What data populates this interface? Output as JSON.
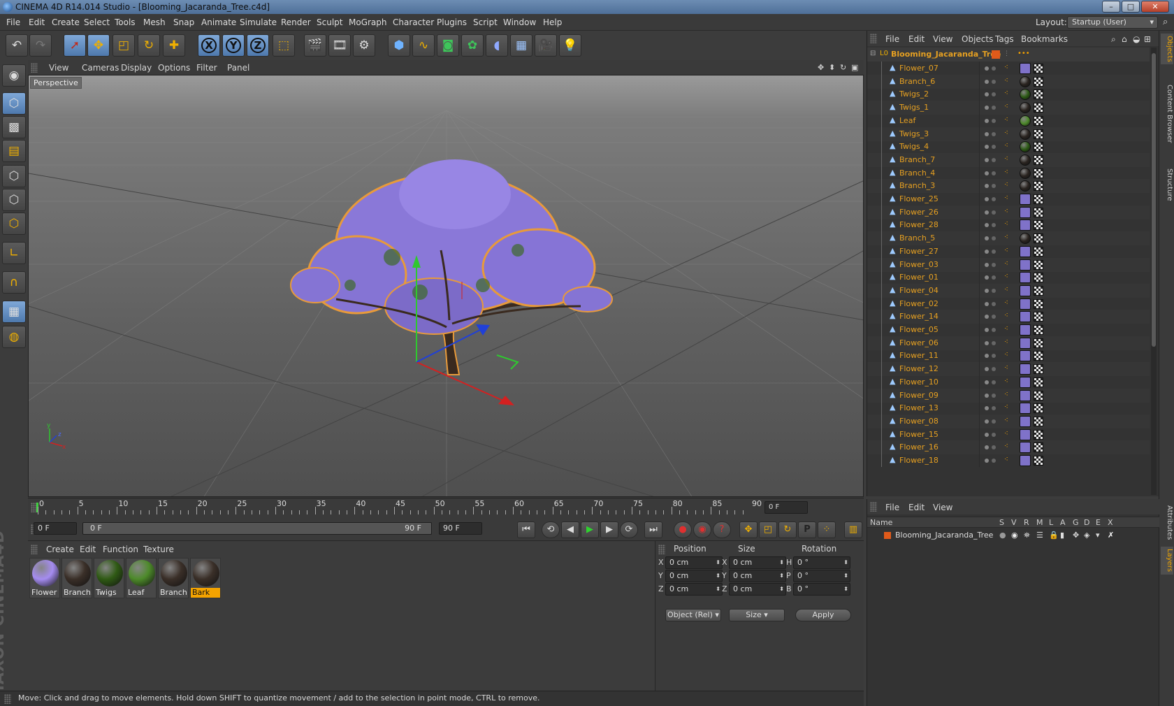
{
  "window": {
    "title": "CINEMA 4D R14.014 Studio - [Blooming_Jacaranda_Tree.c4d]",
    "minimize": "–",
    "maximize": "□",
    "close": "✕"
  },
  "menubar": {
    "items": [
      "File",
      "Edit",
      "Create",
      "Select",
      "Tools",
      "Mesh",
      "Snap",
      "Animate",
      "Simulate",
      "Render",
      "Sculpt",
      "MoGraph",
      "Character",
      "Plugins",
      "Script",
      "Window",
      "Help"
    ],
    "layout_label": "Layout:",
    "layout_value": "Startup (User)"
  },
  "toolbar": {
    "icons": [
      "undo-icon",
      "redo-icon",
      "live-selection-icon",
      "move-icon",
      "scale-icon",
      "rotate-icon",
      "add-icon",
      "x-axis-lock",
      "y-axis-lock",
      "z-axis-lock",
      "coordinate-system-icon",
      "render-view-icon",
      "render-picture-viewer-icon",
      "render-settings-icon",
      "cube-icon",
      "spline-icon",
      "nurbs-icon",
      "array-icon",
      "deformer-icon",
      "floor-icon",
      "camera-icon",
      "light-icon"
    ],
    "axis_labels": [
      "X",
      "Y",
      "Z"
    ]
  },
  "viewport": {
    "menu": [
      "View",
      "Cameras",
      "Display",
      "Options",
      "Filter",
      "Panel"
    ],
    "label": "Perspective"
  },
  "timeline": {
    "ticks": [
      "0",
      "5",
      "10",
      "15",
      "20",
      "25",
      "30",
      "35",
      "40",
      "45",
      "50",
      "55",
      "60",
      "65",
      "70",
      "75",
      "80",
      "85",
      "90"
    ],
    "current_frame": "0 F"
  },
  "transport": {
    "start_field": "0 F",
    "range_start": "0 F",
    "range_end": "90 F",
    "end_field": "90 F"
  },
  "material_manager": {
    "menu": [
      "Create",
      "Edit",
      "Function",
      "Texture"
    ],
    "materials": [
      {
        "name": "Flower",
        "color": "#a58cf0"
      },
      {
        "name": "Branch.",
        "color": "#3a2f28"
      },
      {
        "name": "Twigs",
        "color": "#2f5a14"
      },
      {
        "name": "Leaf",
        "color": "#4d8a2a"
      },
      {
        "name": "Branch",
        "color": "#3a2f28"
      },
      {
        "name": "Bark",
        "color": "#3a2f28",
        "selected": true
      }
    ]
  },
  "coordinates": {
    "headers": [
      "Position",
      "Size",
      "Rotation"
    ],
    "rows": [
      {
        "axis": "X",
        "pos": "0 cm",
        "size_axis": "X",
        "size": "0 cm",
        "rot_axis": "H",
        "rot": "0 °"
      },
      {
        "axis": "Y",
        "pos": "0 cm",
        "size_axis": "Y",
        "size": "0 cm",
        "rot_axis": "P",
        "rot": "0 °"
      },
      {
        "axis": "Z",
        "pos": "0 cm",
        "size_axis": "Z",
        "size": "0 cm",
        "rot_axis": "B",
        "rot": "0 °"
      }
    ],
    "mode_select": "Object (Rel)",
    "size_select": "Size",
    "apply": "Apply"
  },
  "status": "Move: Click and drag to move elements. Hold down SHIFT to quantize movement / add to the selection in point mode, CTRL to remove.",
  "object_manager": {
    "menu": [
      "File",
      "Edit",
      "View",
      "Objects",
      "Tags",
      "Bookmarks"
    ],
    "root": "Blooming_Jacaranda_Tree",
    "objects": [
      {
        "name": "Flower_07",
        "tag": "#9a86e6"
      },
      {
        "name": "Branch_6",
        "tag": "#2a2420"
      },
      {
        "name": "Twigs_2",
        "tag": "#2c5a14"
      },
      {
        "name": "Twigs_1",
        "tag": "#2a2420"
      },
      {
        "name": "Leaf",
        "tag": "#4d8a2a"
      },
      {
        "name": "Twigs_3",
        "tag": "#2a2420"
      },
      {
        "name": "Twigs_4",
        "tag": "#2c5a14"
      },
      {
        "name": "Branch_7",
        "tag": "#2a2420"
      },
      {
        "name": "Branch_4",
        "tag": "#2a2420"
      },
      {
        "name": "Branch_3",
        "tag": "#2a2420"
      },
      {
        "name": "Flower_25",
        "tag": "#9a86e6"
      },
      {
        "name": "Flower_26",
        "tag": "#9a86e6"
      },
      {
        "name": "Flower_28",
        "tag": "#9a86e6"
      },
      {
        "name": "Branch_5",
        "tag": "#2a2420"
      },
      {
        "name": "Flower_27",
        "tag": "#9a86e6"
      },
      {
        "name": "Flower_03",
        "tag": "#9a86e6"
      },
      {
        "name": "Flower_01",
        "tag": "#9a86e6"
      },
      {
        "name": "Flower_04",
        "tag": "#9a86e6"
      },
      {
        "name": "Flower_02",
        "tag": "#9a86e6"
      },
      {
        "name": "Flower_14",
        "tag": "#9a86e6"
      },
      {
        "name": "Flower_05",
        "tag": "#9a86e6"
      },
      {
        "name": "Flower_06",
        "tag": "#9a86e6"
      },
      {
        "name": "Flower_11",
        "tag": "#9a86e6"
      },
      {
        "name": "Flower_12",
        "tag": "#9a86e6"
      },
      {
        "name": "Flower_10",
        "tag": "#9a86e6"
      },
      {
        "name": "Flower_09",
        "tag": "#9a86e6"
      },
      {
        "name": "Flower_13",
        "tag": "#9a86e6"
      },
      {
        "name": "Flower_08",
        "tag": "#9a86e6"
      },
      {
        "name": "Flower_15",
        "tag": "#9a86e6"
      },
      {
        "name": "Flower_16",
        "tag": "#9a86e6"
      },
      {
        "name": "Flower_18",
        "tag": "#9a86e6"
      }
    ]
  },
  "side_tabs": [
    "Objects",
    "Content Browser",
    "Structure",
    "Attributes",
    "Layers"
  ],
  "layer_manager": {
    "menu": [
      "File",
      "Edit",
      "View"
    ],
    "columns": [
      "Name",
      "S",
      "V",
      "R",
      "M",
      "L",
      "A",
      "G",
      "D",
      "E",
      "X"
    ],
    "row_name": "Blooming_Jacaranda_Tree"
  },
  "colors": {
    "accent": "#f4a300",
    "object_name": "#e6a021",
    "selection_blue": "#6f98cc"
  }
}
